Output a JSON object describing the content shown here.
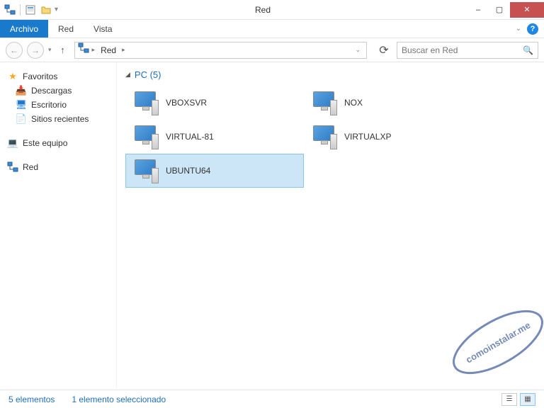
{
  "window": {
    "title": "Red",
    "minimize": "–",
    "maximize": "▢",
    "close": "✕"
  },
  "ribbon": {
    "tabs": [
      "Archivo",
      "Red",
      "Vista"
    ]
  },
  "nav": {
    "location": "Red",
    "search_placeholder": "Buscar en Red"
  },
  "sidebar": {
    "favorites": {
      "label": "Favoritos",
      "items": [
        "Descargas",
        "Escritorio",
        "Sitios recientes"
      ]
    },
    "this_pc": "Este equipo",
    "network": "Red"
  },
  "main": {
    "group_label": "PC (5)",
    "items": [
      {
        "name": "VBOXSVR",
        "selected": false
      },
      {
        "name": "NOX",
        "selected": false
      },
      {
        "name": "VIRTUAL-81",
        "selected": false
      },
      {
        "name": "VIRTUALXP",
        "selected": false
      },
      {
        "name": "UBUNTU64",
        "selected": true
      }
    ]
  },
  "statusbar": {
    "count": "5 elementos",
    "selection": "1 elemento seleccionado"
  },
  "watermark": "comoinstalar.me"
}
